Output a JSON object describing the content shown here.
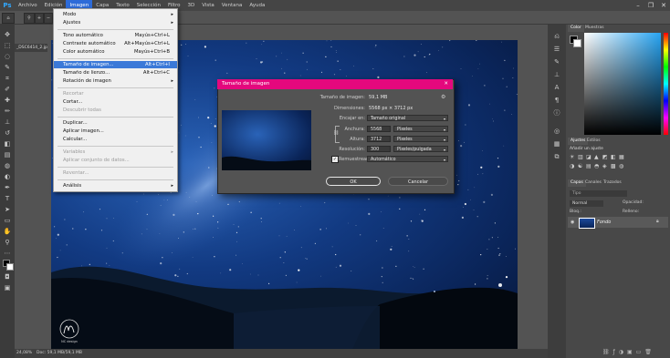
{
  "menubar": {
    "logo": "Ps",
    "items": [
      "Archivo",
      "Edición",
      "Imagen",
      "Capa",
      "Texto",
      "Selección",
      "Filtro",
      "3D",
      "Vista",
      "Ventana",
      "Ayuda"
    ],
    "active_index": 2
  },
  "document": {
    "tab_title": "_DSC6414_2.jpg al 24,1% (RGB/8#)",
    "zoom": "24,08%",
    "doc_info": "Doc: 59,1 MB/59,1 MB",
    "watermark_signature": "NC design"
  },
  "menu": {
    "items": [
      {
        "label": "Modo",
        "shortcut": "",
        "submenu": true,
        "disabled": false,
        "highlighted": false,
        "underline_index": 0
      },
      {
        "label": "Ajustes",
        "shortcut": "",
        "submenu": true,
        "disabled": false,
        "highlighted": false,
        "underline_index": 0
      },
      {
        "label": "Tono automático",
        "shortcut": "Mayús+Ctrl+L",
        "submenu": false,
        "disabled": false,
        "highlighted": false
      },
      {
        "label": "Contraste automático",
        "shortcut": "Alt+Mayús+Ctrl+L",
        "submenu": false,
        "disabled": false,
        "highlighted": false
      },
      {
        "label": "Color automático",
        "shortcut": "Mayús+Ctrl+B",
        "submenu": false,
        "disabled": false,
        "highlighted": false
      },
      {
        "label": "Tamaño de imagen...",
        "shortcut": "Alt+Ctrl+I",
        "submenu": false,
        "disabled": false,
        "highlighted": true
      },
      {
        "label": "Tamaño de lienzo...",
        "shortcut": "Alt+Ctrl+C",
        "submenu": false,
        "disabled": false,
        "highlighted": false
      },
      {
        "label": "Rotación de imagen",
        "shortcut": "",
        "submenu": true,
        "disabled": false,
        "highlighted": false
      },
      {
        "label": "Recortar",
        "shortcut": "",
        "submenu": false,
        "disabled": true,
        "highlighted": false
      },
      {
        "label": "Cortar...",
        "shortcut": "",
        "submenu": false,
        "disabled": false,
        "highlighted": false
      },
      {
        "label": "Descubrir todas",
        "shortcut": "",
        "submenu": false,
        "disabled": true,
        "highlighted": false
      },
      {
        "label": "Duplicar...",
        "shortcut": "",
        "submenu": false,
        "disabled": false,
        "highlighted": false
      },
      {
        "label": "Aplicar imagen...",
        "shortcut": "",
        "submenu": false,
        "disabled": false,
        "highlighted": false
      },
      {
        "label": "Calcular...",
        "shortcut": "",
        "submenu": false,
        "disabled": false,
        "highlighted": false
      },
      {
        "label": "Variables",
        "shortcut": "",
        "submenu": true,
        "disabled": true,
        "highlighted": false
      },
      {
        "label": "Aplicar conjunto de datos...",
        "shortcut": "",
        "submenu": false,
        "disabled": true,
        "highlighted": false
      },
      {
        "label": "Reventar...",
        "shortcut": "",
        "submenu": false,
        "disabled": true,
        "highlighted": false
      },
      {
        "label": "Análisis",
        "shortcut": "",
        "submenu": true,
        "disabled": false,
        "highlighted": false
      }
    ]
  },
  "dialog": {
    "title": "Tamaño de imagen",
    "close": "✕",
    "size_label": "Tamaño de imagen:",
    "size_value": "59,1 MB",
    "dims_label": "Dimensiones:",
    "dims_value": "5568 px × 3712 px",
    "fit_label": "Encajar en:",
    "fit_value": "Tamaño original",
    "width_label": "Anchura:",
    "width_value": "5568",
    "width_unit": "Píxeles",
    "height_label": "Altura:",
    "height_value": "3712",
    "height_unit": "Píxeles",
    "res_label": "Resolución:",
    "res_value": "300",
    "res_unit": "Píxeles/pulgada",
    "resample_label": "Remuestrear:",
    "resample_checked": true,
    "resample_value": "Automático",
    "ok_label": "OK",
    "cancel_label": "Cancelar"
  },
  "right_panel": {
    "color_tabs": [
      "Color",
      "Muestras"
    ],
    "adjust_tabs": [
      "Ajustes",
      "Estilos"
    ],
    "adjust_heading": "Añadir un ajuste",
    "layer_tabs": [
      "Capas",
      "Canales",
      "Trazados"
    ],
    "search_placeholder": "Tipo",
    "blend_mode": "Normal",
    "opacity_label": "Opacidad:",
    "lock_label": "Bloq.:",
    "fill_label": "Relleno:",
    "layer_name": "Fondo"
  },
  "colors": {
    "ps_blue": "#31a8ff",
    "dialog_title_bg": "#e4087d",
    "menu_highlight": "#3b79d8",
    "ok_button_border": "#e6e6e6"
  }
}
